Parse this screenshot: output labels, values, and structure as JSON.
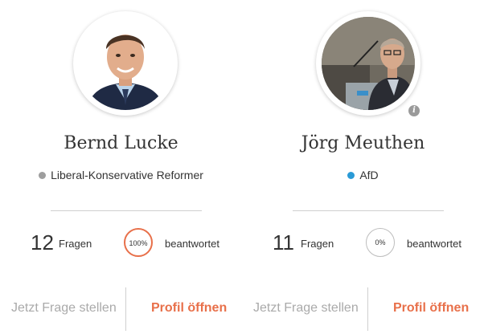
{
  "candidates": [
    {
      "name": "Bernd Lucke",
      "party": "Liberal-Konservative Reformer",
      "party_color": "#9e9e9e",
      "question_count": "12",
      "questions_label": "Fragen",
      "answered_percent": "100%",
      "answered_label": "beantwortet",
      "ask_label": "Jetzt Frage stellen",
      "profile_label": "Profil öffnen"
    },
    {
      "name": "Jörg Meuthen",
      "party": "AfD",
      "party_color": "#2a9ad6",
      "question_count": "11",
      "questions_label": "Fragen",
      "answered_percent": "0%",
      "answered_label": "beantwortet",
      "ask_label": "Jetzt Frage stellen",
      "profile_label": "Profil öffnen",
      "info_icon": "i"
    }
  ],
  "colors": {
    "accent": "#e8704a",
    "muted": "#aaaaaa"
  }
}
